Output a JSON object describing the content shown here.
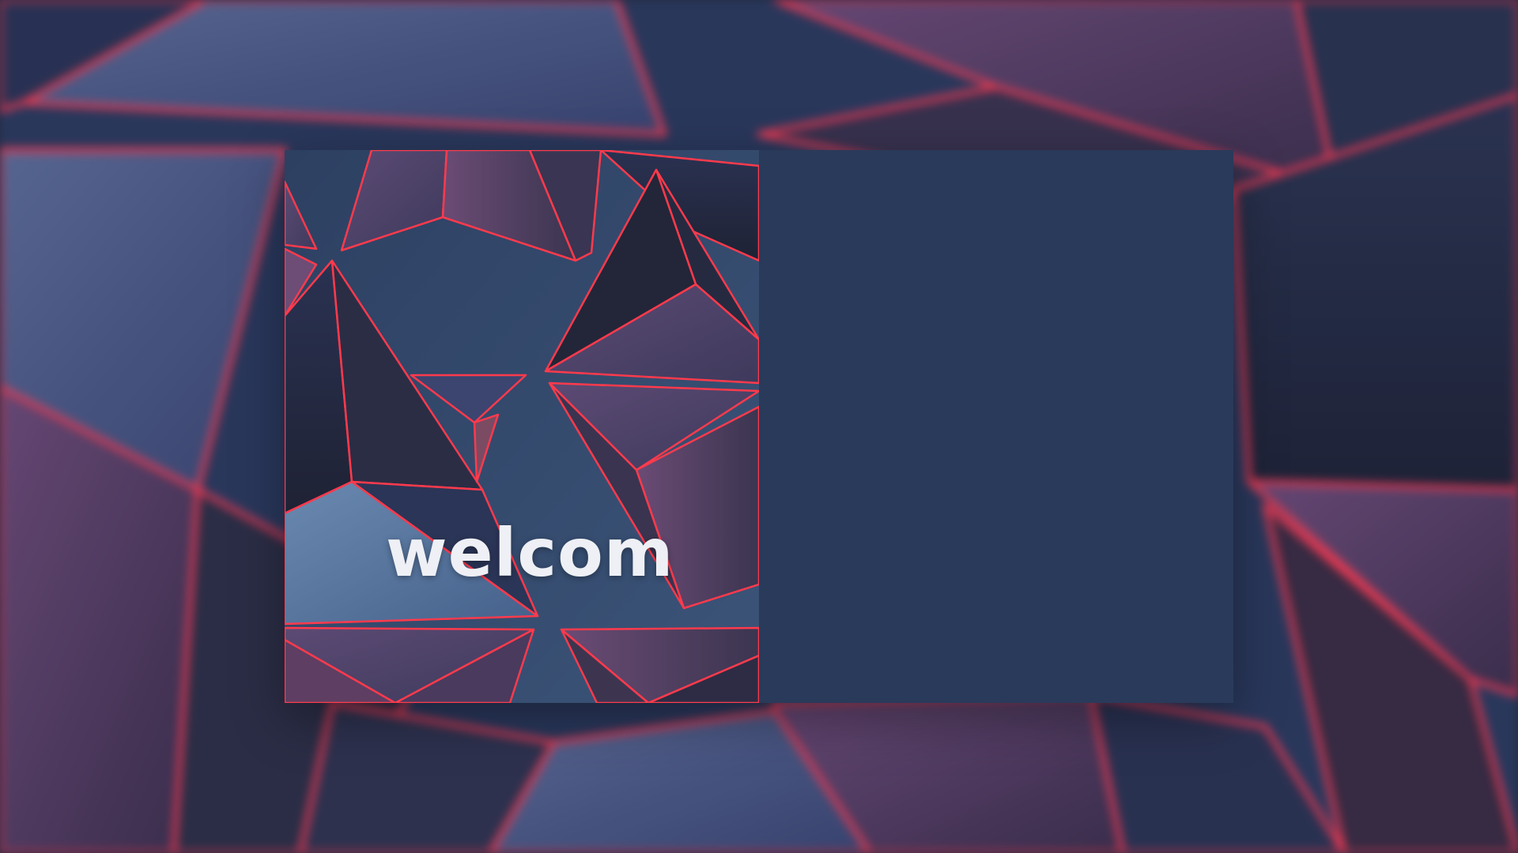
{
  "background": {
    "description_icon": "triangle-pattern-icon",
    "colors": {
      "base": "#2a3b5e",
      "face_light": "#4e6790",
      "face_mid": "#3b4a72",
      "face_purple": "#5a3e66",
      "face_dark": "#222535",
      "edge_glow": "#ff3b4e"
    }
  },
  "card": {
    "welcome_text": "welcom",
    "right_panel_color": "#2a3a5a",
    "left_panel_image_icon": "geometric-pattern-icon"
  }
}
